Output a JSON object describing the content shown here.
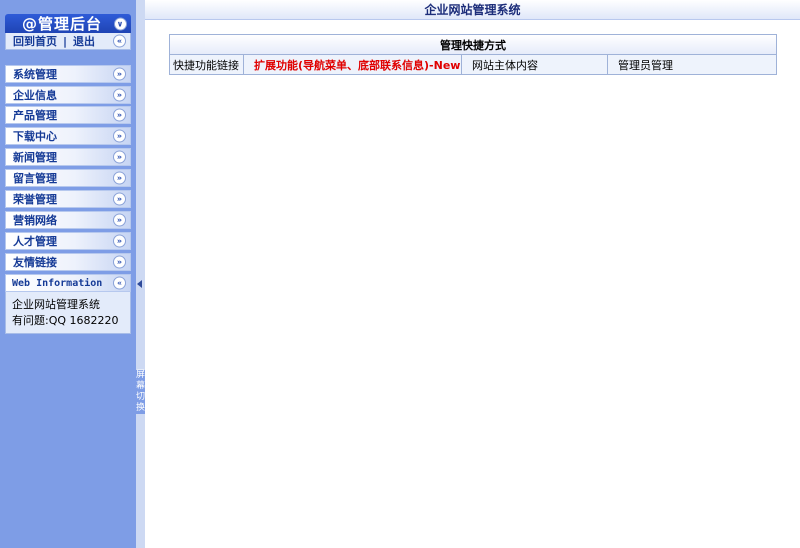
{
  "sidebar": {
    "header_title": "@管理后台",
    "home_link": "回到首页",
    "separator": "|",
    "logout_link": "退出",
    "menu": [
      {
        "label": "系统管理"
      },
      {
        "label": "企业信息"
      },
      {
        "label": "产品管理"
      },
      {
        "label": "下载中心"
      },
      {
        "label": "新闻管理"
      },
      {
        "label": "留言管理"
      },
      {
        "label": "荣誉管理"
      },
      {
        "label": "营销网络"
      },
      {
        "label": "人才管理"
      },
      {
        "label": "友情链接"
      }
    ],
    "info": {
      "title": "Web Information",
      "line1": "企业网站管理系统",
      "line2": "有问题:QQ 1682220"
    }
  },
  "splitter": {
    "label": "屏幕切换"
  },
  "topbar": {
    "title": "企业网站管理系统"
  },
  "shortcut": {
    "title": "管理快捷方式",
    "row_label": "快捷功能链接",
    "links": [
      "扩展功能(导航菜单、底部联系信息)-New",
      "网站主体内容",
      "管理员管理"
    ]
  },
  "colors": {
    "sidebar_bg": "#7e9de6",
    "header_blue": "#1f44b4",
    "link_red": "#e00000",
    "menu_text": "#153a96"
  }
}
